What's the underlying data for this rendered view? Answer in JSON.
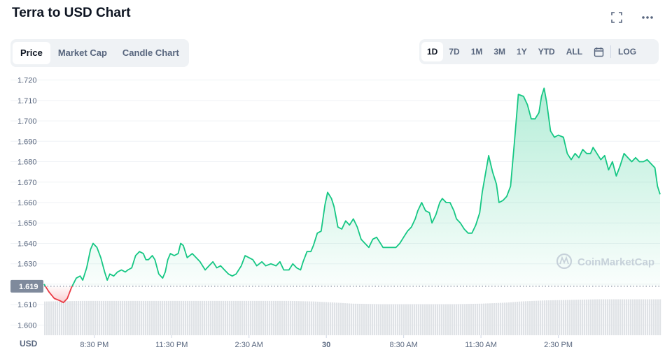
{
  "header": {
    "title": "Terra to USD Chart",
    "fullscreen_icon": "fullscreen-icon",
    "more_icon": "more-horizontal-icon"
  },
  "chart_tabs": [
    {
      "label": "Price",
      "active": true
    },
    {
      "label": "Market Cap",
      "active": false
    },
    {
      "label": "Candle Chart",
      "active": false
    }
  ],
  "ranges": [
    {
      "label": "1D",
      "active": true
    },
    {
      "label": "7D",
      "active": false
    },
    {
      "label": "1M",
      "active": false
    },
    {
      "label": "3M",
      "active": false
    },
    {
      "label": "1Y",
      "active": false
    },
    {
      "label": "YTD",
      "active": false
    },
    {
      "label": "ALL",
      "active": false
    }
  ],
  "calendar_icon": "calendar-icon",
  "log_label": "LOG",
  "watermark": "CoinMarketCap",
  "colors": {
    "up": "#16c784",
    "down": "#ea3943",
    "grid": "#eff2f5",
    "axis_text": "#58667e",
    "volume": "#dfe2e6",
    "reference": "#616e85"
  },
  "chart_data": {
    "type": "area",
    "title": "Terra to USD Chart",
    "currency_label": "USD",
    "reference_value": 1.619,
    "reference_label": "1.619",
    "ylim": [
      1.595,
      1.725
    ],
    "y_ticks": [
      "1.600",
      "1.610",
      "1.620",
      "1.630",
      "1.640",
      "1.650",
      "1.660",
      "1.670",
      "1.680",
      "1.690",
      "1.700",
      "1.710",
      "1.720"
    ],
    "x_ticks": [
      {
        "label": "8:30 PM",
        "hour": 2.5
      },
      {
        "label": "11:30 PM",
        "hour": 5.5
      },
      {
        "label": "2:30 AM",
        "hour": 8.5
      },
      {
        "label": "30",
        "hour": 11.5
      },
      {
        "label": "8:30 AM",
        "hour": 14.5
      },
      {
        "label": "11:30 AM",
        "hour": 17.5
      },
      {
        "label": "2:30 PM",
        "hour": 20.5
      }
    ],
    "x_range_hours": [
      0.55,
      24.45
    ],
    "grid": true,
    "price_series": {
      "name": "Price",
      "points": [
        [
          0.55,
          1.62
        ],
        [
          0.75,
          1.616
        ],
        [
          0.95,
          1.613
        ],
        [
          1.15,
          1.612
        ],
        [
          1.3,
          1.611
        ],
        [
          1.45,
          1.613
        ],
        [
          1.6,
          1.618
        ],
        [
          1.8,
          1.623
        ],
        [
          1.95,
          1.624
        ],
        [
          2.05,
          1.622
        ],
        [
          2.2,
          1.628
        ],
        [
          2.35,
          1.637
        ],
        [
          2.45,
          1.64
        ],
        [
          2.6,
          1.638
        ],
        [
          2.75,
          1.633
        ],
        [
          2.9,
          1.626
        ],
        [
          3.0,
          1.622
        ],
        [
          3.1,
          1.625
        ],
        [
          3.25,
          1.624
        ],
        [
          3.4,
          1.626
        ],
        [
          3.55,
          1.627
        ],
        [
          3.7,
          1.626
        ],
        [
          3.8,
          1.627
        ],
        [
          3.95,
          1.628
        ],
        [
          4.1,
          1.634
        ],
        [
          4.25,
          1.636
        ],
        [
          4.4,
          1.635
        ],
        [
          4.5,
          1.632
        ],
        [
          4.6,
          1.632
        ],
        [
          4.75,
          1.634
        ],
        [
          4.85,
          1.632
        ],
        [
          5.0,
          1.625
        ],
        [
          5.15,
          1.623
        ],
        [
          5.25,
          1.626
        ],
        [
          5.35,
          1.632
        ],
        [
          5.45,
          1.635
        ],
        [
          5.6,
          1.634
        ],
        [
          5.75,
          1.635
        ],
        [
          5.85,
          1.64
        ],
        [
          5.95,
          1.639
        ],
        [
          6.1,
          1.633
        ],
        [
          6.3,
          1.635
        ],
        [
          6.45,
          1.633
        ],
        [
          6.6,
          1.631
        ],
        [
          6.8,
          1.627
        ],
        [
          6.95,
          1.629
        ],
        [
          7.1,
          1.631
        ],
        [
          7.25,
          1.628
        ],
        [
          7.4,
          1.629
        ],
        [
          7.55,
          1.627
        ],
        [
          7.7,
          1.625
        ],
        [
          7.85,
          1.624
        ],
        [
          8.0,
          1.625
        ],
        [
          8.2,
          1.629
        ],
        [
          8.35,
          1.634
        ],
        [
          8.5,
          1.633
        ],
        [
          8.65,
          1.632
        ],
        [
          8.8,
          1.629
        ],
        [
          9.0,
          1.631
        ],
        [
          9.15,
          1.629
        ],
        [
          9.35,
          1.63
        ],
        [
          9.55,
          1.629
        ],
        [
          9.7,
          1.631
        ],
        [
          9.85,
          1.627
        ],
        [
          10.05,
          1.627
        ],
        [
          10.2,
          1.63
        ],
        [
          10.35,
          1.628
        ],
        [
          10.5,
          1.627
        ],
        [
          10.6,
          1.631
        ],
        [
          10.75,
          1.636
        ],
        [
          10.9,
          1.636
        ],
        [
          11.0,
          1.639
        ],
        [
          11.15,
          1.645
        ],
        [
          11.3,
          1.646
        ],
        [
          11.45,
          1.659
        ],
        [
          11.55,
          1.665
        ],
        [
          11.7,
          1.662
        ],
        [
          11.8,
          1.658
        ],
        [
          11.95,
          1.648
        ],
        [
          12.1,
          1.647
        ],
        [
          12.25,
          1.651
        ],
        [
          12.4,
          1.649
        ],
        [
          12.55,
          1.652
        ],
        [
          12.7,
          1.648
        ],
        [
          12.85,
          1.642
        ],
        [
          13.0,
          1.64
        ],
        [
          13.15,
          1.638
        ],
        [
          13.3,
          1.642
        ],
        [
          13.45,
          1.643
        ],
        [
          13.55,
          1.641
        ],
        [
          13.7,
          1.638
        ],
        [
          13.85,
          1.638
        ],
        [
          14.0,
          1.638
        ],
        [
          14.2,
          1.638
        ],
        [
          14.35,
          1.64
        ],
        [
          14.5,
          1.643
        ],
        [
          14.65,
          1.646
        ],
        [
          14.8,
          1.648
        ],
        [
          14.95,
          1.652
        ],
        [
          15.05,
          1.656
        ],
        [
          15.2,
          1.66
        ],
        [
          15.35,
          1.656
        ],
        [
          15.5,
          1.655
        ],
        [
          15.6,
          1.65
        ],
        [
          15.75,
          1.654
        ],
        [
          15.9,
          1.66
        ],
        [
          16.0,
          1.662
        ],
        [
          16.15,
          1.66
        ],
        [
          16.3,
          1.66
        ],
        [
          16.45,
          1.656
        ],
        [
          16.55,
          1.652
        ],
        [
          16.7,
          1.65
        ],
        [
          16.85,
          1.647
        ],
        [
          17.0,
          1.645
        ],
        [
          17.15,
          1.645
        ],
        [
          17.3,
          1.649
        ],
        [
          17.45,
          1.655
        ],
        [
          17.55,
          1.665
        ],
        [
          17.7,
          1.676
        ],
        [
          17.8,
          1.683
        ],
        [
          17.95,
          1.675
        ],
        [
          18.1,
          1.669
        ],
        [
          18.2,
          1.66
        ],
        [
          18.35,
          1.661
        ],
        [
          18.5,
          1.663
        ],
        [
          18.65,
          1.668
        ],
        [
          18.8,
          1.69
        ],
        [
          18.95,
          1.713
        ],
        [
          19.15,
          1.712
        ],
        [
          19.3,
          1.708
        ],
        [
          19.45,
          1.701
        ],
        [
          19.6,
          1.701
        ],
        [
          19.75,
          1.704
        ],
        [
          19.85,
          1.712
        ],
        [
          19.95,
          1.716
        ],
        [
          20.05,
          1.709
        ],
        [
          20.2,
          1.695
        ],
        [
          20.35,
          1.692
        ],
        [
          20.5,
          1.693
        ],
        [
          20.7,
          1.692
        ],
        [
          20.85,
          1.684
        ],
        [
          21.0,
          1.681
        ],
        [
          21.15,
          1.684
        ],
        [
          21.3,
          1.682
        ],
        [
          21.45,
          1.686
        ],
        [
          21.6,
          1.684
        ],
        [
          21.75,
          1.684
        ],
        [
          21.85,
          1.687
        ],
        [
          22.0,
          1.684
        ],
        [
          22.15,
          1.681
        ],
        [
          22.3,
          1.683
        ],
        [
          22.45,
          1.676
        ],
        [
          22.6,
          1.68
        ],
        [
          22.75,
          1.673
        ],
        [
          22.9,
          1.678
        ],
        [
          23.05,
          1.684
        ],
        [
          23.2,
          1.682
        ],
        [
          23.35,
          1.68
        ],
        [
          23.5,
          1.682
        ],
        [
          23.65,
          1.68
        ],
        [
          23.8,
          1.68
        ],
        [
          23.95,
          1.681
        ],
        [
          24.1,
          1.679
        ],
        [
          24.25,
          1.677
        ],
        [
          24.35,
          1.668
        ],
        [
          24.45,
          1.664
        ]
      ]
    },
    "volume_series": {
      "name": "Volume",
      "points": [
        [
          0.55,
          0.62
        ],
        [
          2.0,
          0.63
        ],
        [
          4.0,
          0.63
        ],
        [
          6.0,
          0.63
        ],
        [
          8.0,
          0.63
        ],
        [
          10.0,
          0.63
        ],
        [
          11.0,
          0.62
        ],
        [
          11.8,
          0.6
        ],
        [
          12.5,
          0.58
        ],
        [
          13.5,
          0.57
        ],
        [
          15.0,
          0.57
        ],
        [
          16.5,
          0.57
        ],
        [
          17.5,
          0.58
        ],
        [
          18.5,
          0.6
        ],
        [
          19.0,
          0.62
        ],
        [
          20.0,
          0.64
        ],
        [
          21.0,
          0.65
        ],
        [
          22.0,
          0.66
        ],
        [
          23.0,
          0.66
        ],
        [
          24.45,
          0.66
        ]
      ]
    }
  }
}
